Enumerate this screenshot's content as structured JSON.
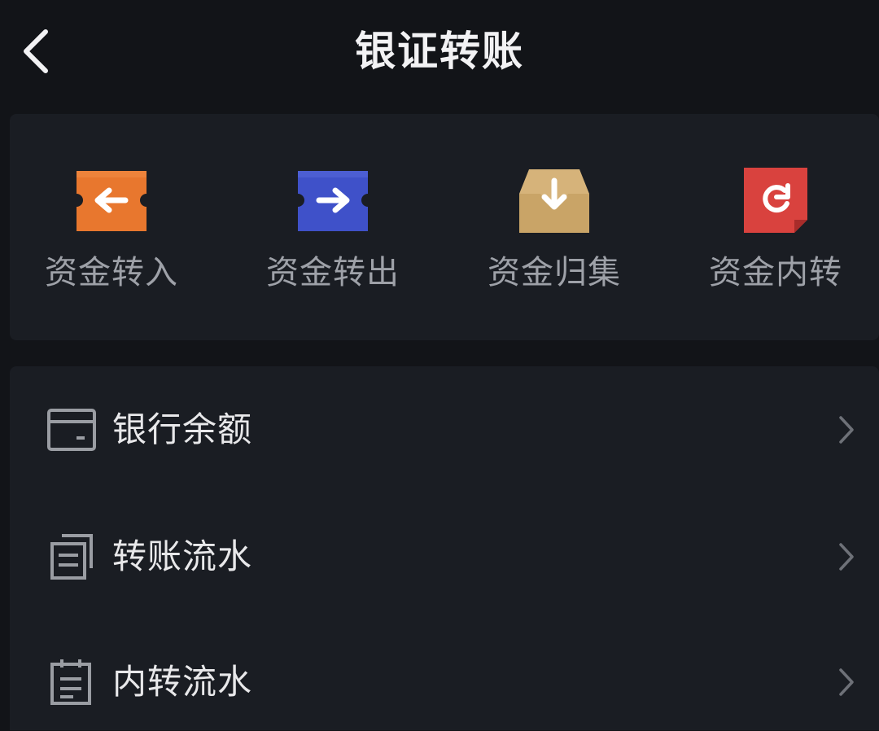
{
  "header": {
    "title": "银证转账"
  },
  "actions": [
    {
      "label": "资金转入",
      "icon": "arrow-left-ticket-icon",
      "color": "#E8772E"
    },
    {
      "label": "资金转出",
      "icon": "arrow-right-ticket-icon",
      "color": "#3F51C9"
    },
    {
      "label": "资金归集",
      "icon": "inbox-download-icon",
      "color": "#D6B37A"
    },
    {
      "label": "资金内转",
      "icon": "rotate-document-icon",
      "color": "#D9423E"
    }
  ],
  "list": [
    {
      "label": "银行余额",
      "icon": "bank-card-icon"
    },
    {
      "label": "转账流水",
      "icon": "stacked-records-icon"
    },
    {
      "label": "内转流水",
      "icon": "notepad-icon"
    }
  ],
  "colors": {
    "background": "#121418",
    "card": "#1A1D23",
    "title": "#F2F2F4",
    "action_label": "#9EA1A8",
    "list_label": "#E8E8EA",
    "icon_gray": "#9A9DA3"
  }
}
